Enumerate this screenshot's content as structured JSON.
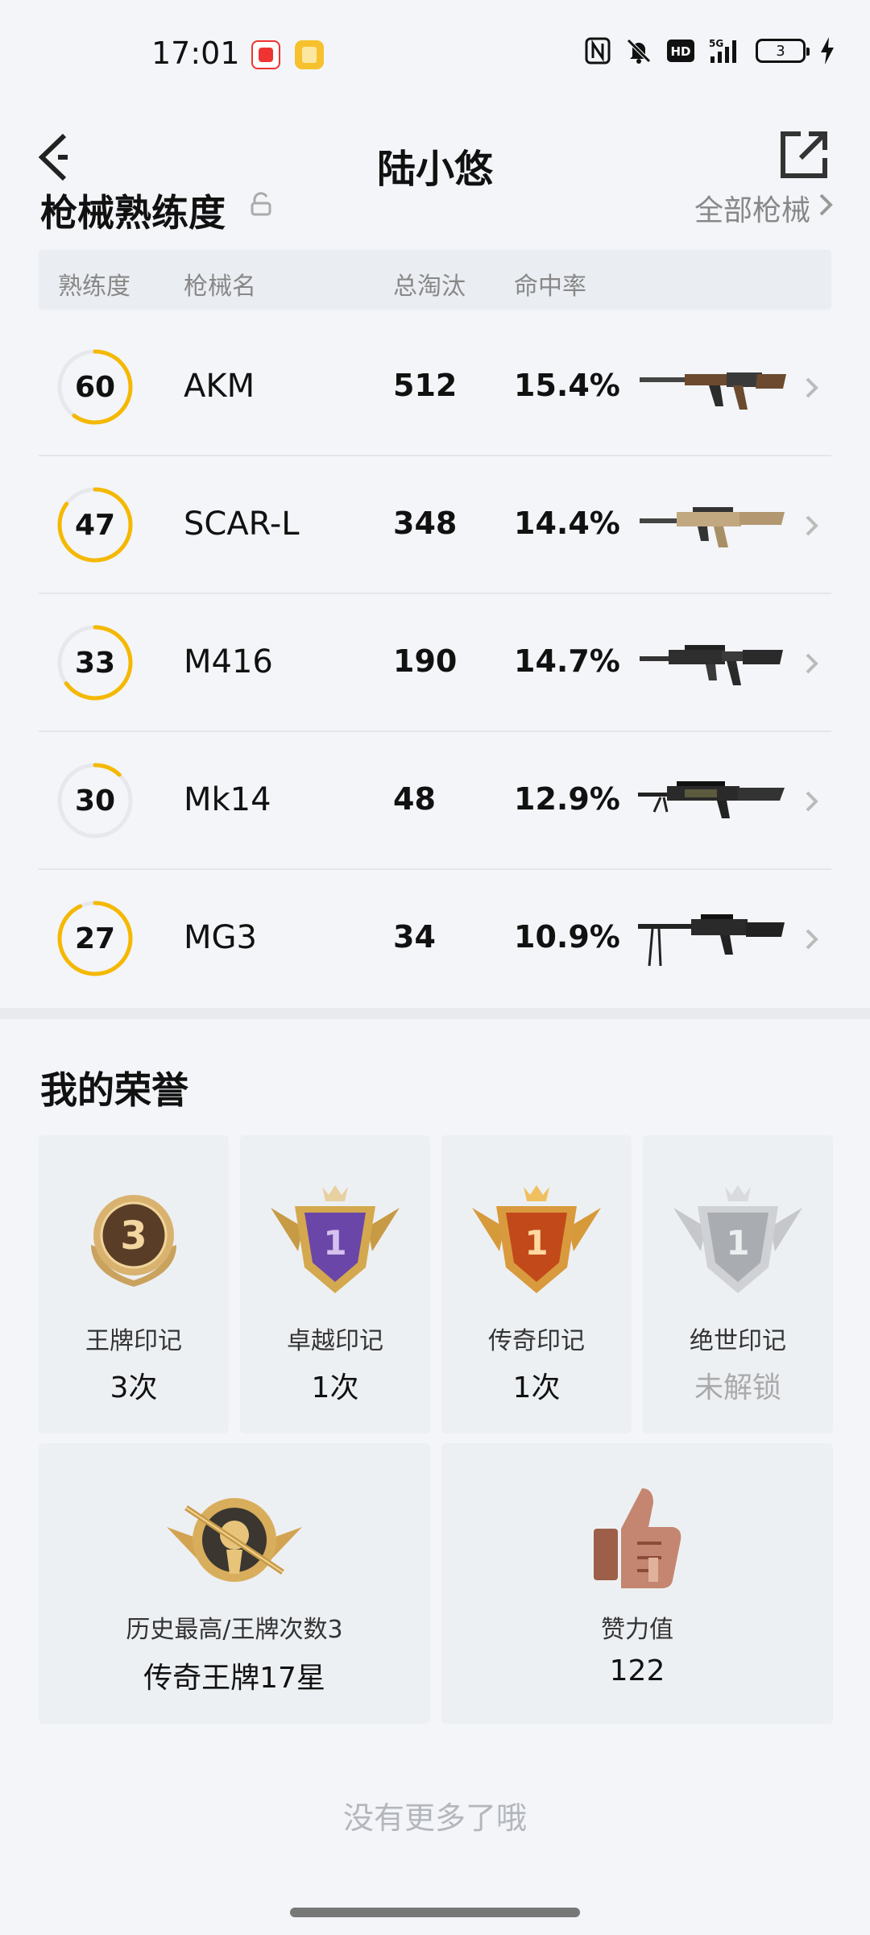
{
  "status_bar": {
    "time": "17:01",
    "battery": "3"
  },
  "header": {
    "title": "陆小悠"
  },
  "weapon_section": {
    "title": "枪械熟练度",
    "all_link": "全部枪械",
    "columns": [
      "熟练度",
      "枪械名",
      "总淘汰",
      "命中率"
    ],
    "rows": [
      {
        "level": "60",
        "progress": 0.6,
        "name": "AKM",
        "kills": "512",
        "rate": "15.4%"
      },
      {
        "level": "47",
        "progress": 0.85,
        "name": "SCAR-L",
        "kills": "348",
        "rate": "14.4%"
      },
      {
        "level": "33",
        "progress": 0.65,
        "name": "M416",
        "kills": "190",
        "rate": "14.7%"
      },
      {
        "level": "30",
        "progress": 0.12,
        "name": "Mk14",
        "kills": "48",
        "rate": "12.9%"
      },
      {
        "level": "27",
        "progress": 0.93,
        "name": "MG3",
        "kills": "34",
        "rate": "10.9%"
      }
    ]
  },
  "honors": {
    "title": "我的荣誉",
    "cards": [
      {
        "badge_num": "3",
        "label": "王牌印记",
        "value": "3次"
      },
      {
        "badge_num": "1",
        "label": "卓越印记",
        "value": "1次"
      },
      {
        "badge_num": "1",
        "label": "传奇印记",
        "value": "1次"
      },
      {
        "badge_num": "1",
        "label": "绝世印记",
        "value": "未解锁"
      }
    ],
    "wide_cards": [
      {
        "label": "历史最高/王牌次数3",
        "value": "传奇王牌17星"
      },
      {
        "label": "赞力值",
        "value": "122"
      }
    ]
  },
  "footer": {
    "note": "没有更多了哦"
  },
  "colors": {
    "accent_ring": "#f5b800",
    "ring_track": "#e6e8ec"
  }
}
